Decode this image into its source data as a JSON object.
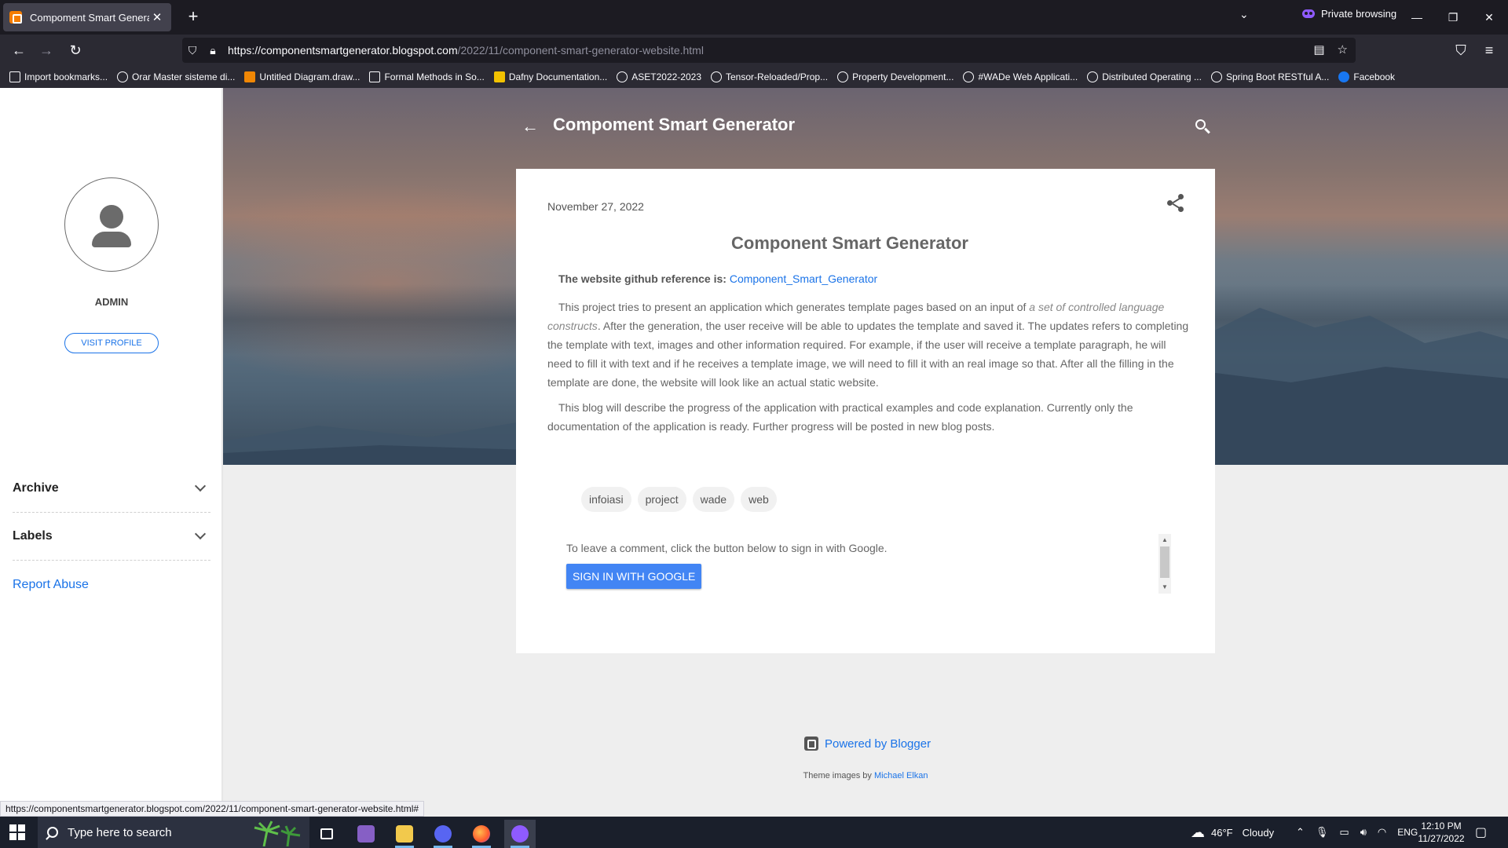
{
  "browser": {
    "tab_title": "Compoment Smart Generator",
    "new_tab": "+",
    "private_label": "Private browsing",
    "url_domain": "https://componentsmartgenerator.blogspot.com",
    "url_path": "/2022/11/component-smart-generator-website.html",
    "bookmarks": [
      "Import bookmarks...",
      "Orar Master sisteme di...",
      "Untitled Diagram.draw...",
      "Formal Methods in So...",
      "Dafny Documentation...",
      "ASET2022-2023",
      "Tensor-Reloaded/Prop...",
      "Property Development...",
      "#WADe Web Applicati...",
      "Distributed Operating ...",
      "Spring Boot RESTful A...",
      "Facebook"
    ]
  },
  "blog": {
    "title": "Compoment Smart Generator",
    "sidebar": {
      "profile_name": "ADMIN",
      "visit_profile": "VISIT PROFILE",
      "archive": "Archive",
      "labels": "Labels",
      "report_abuse": "Report Abuse"
    },
    "post": {
      "date": "November 27, 2022",
      "title": "Component Smart Generator",
      "github_prefix": "The website github reference is:",
      "github_link": "Component_Smart_Generator",
      "p1_start": "This project tries to present an application which generates template pages based on an input of ",
      "p1_italic": "a set of controlled language constructs",
      "p1_end": ". After the generation, the user receive will be able to updates the template and saved it. The updates refers to completing the template with text, images and other information required. For example, if  the user will receive a template paragraph, he will need to fill it with text and if he receives a template image, we will need to fill it with an real image so that. After all the filling in the template are done, the website will look like an actual static website.",
      "p2": "This blog will describe the progress of the application with practical examples and code explanation. Currently only the documentation of the application is ready. Further progress will be posted in new blog posts.",
      "labels": [
        "infoiasi",
        "project",
        "wade",
        "web"
      ]
    },
    "comments": {
      "prompt": "To leave a comment, click the button below to sign in with Google.",
      "signin": "SIGN IN WITH GOOGLE"
    },
    "footer": {
      "powered_by": "Powered by Blogger",
      "theme_prefix": "Theme images by",
      "theme_author": "Michael Elkan"
    }
  },
  "status_url": "https://componentsmartgenerator.blogspot.com/2022/11/component-smart-generator-website.html#",
  "taskbar": {
    "search_placeholder": "Type here to search",
    "weather_temp": "46°F",
    "weather_desc": "Cloudy",
    "lang": "ENG",
    "time": "12:10 PM",
    "date": "11/27/2022"
  },
  "colors": {
    "link": "#1a73e8",
    "signin_button": "#4285f4",
    "blogger_orange": "#f57d00"
  }
}
